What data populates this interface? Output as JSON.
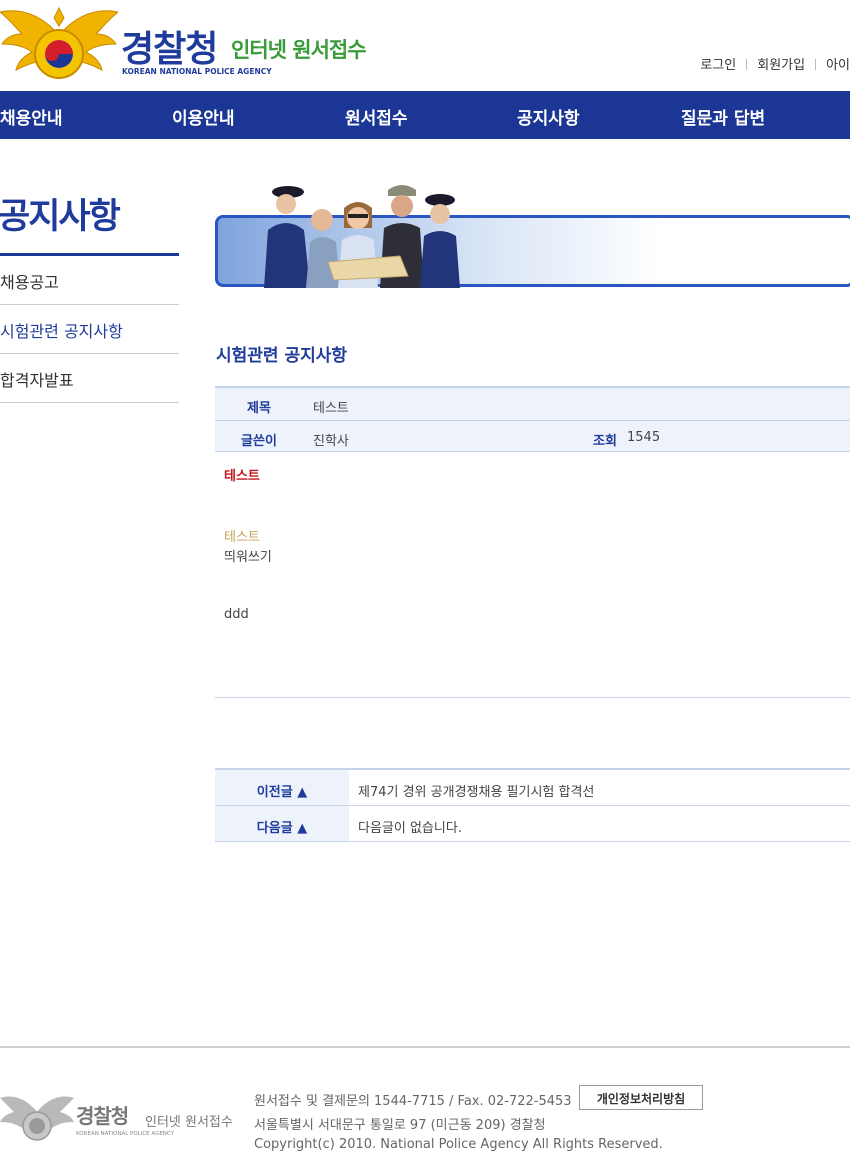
{
  "header": {
    "logo_kr": "경찰청",
    "logo_sub": "인터넷 원서접수",
    "logo_en": "KOREAN NATIONAL POLICE AGENCY",
    "util": [
      "로그인",
      "회원가입",
      "아이"
    ]
  },
  "gnb": [
    "채용안내",
    "이용안내",
    "원서접수",
    "공지사항",
    "질문과 답변"
  ],
  "lnb": {
    "title": "공지사항",
    "items": [
      "채용공고",
      "시험관련 공지사항",
      "합격자발표"
    ],
    "active_index": 1
  },
  "content": {
    "title": "시험관련 공지사항",
    "subject_label": "제목",
    "subject": "테스트",
    "writer_label": "글쓴이",
    "writer": "진학사",
    "views_label": "조회",
    "views": "1545",
    "body": [
      "테스트",
      "테스트",
      "띄워쓰기",
      "ddd"
    ]
  },
  "nav": {
    "prev_label": "이전글",
    "prev_text": "제74기 경위 공개경쟁채용 필기시험 합격선",
    "next_label": "다음글",
    "next_text": "다음글이 없습니다."
  },
  "footer": {
    "logo_kr": "경찰청",
    "logo_sub": "인터넷 원서접수",
    "logo_en": "KOREAN NATIONAL POLICE AGENCY",
    "line1": "원서접수 및 결제문의 1544-7715 / Fax. 02-722-5453",
    "privacy_button": "개인정보처리방침",
    "line2": "서울특별시 서대문구 통일로 97 (미근동 209) 경찰청",
    "line3": "Copyright(c) 2010. National Police Agency All Rights Reserved."
  },
  "colors": {
    "brand_blue": "#1b3694",
    "brand_green": "#3a9b3a",
    "highlight_red": "#c0181e",
    "accent_gold": "#c9a25a"
  }
}
